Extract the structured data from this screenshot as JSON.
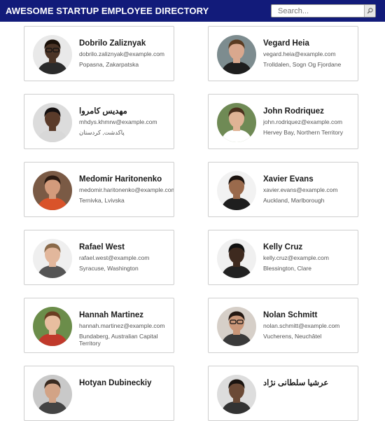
{
  "header": {
    "title": "AWESOME STARTUP EMPLOYEE DIRECTORY",
    "background": "#121b7a",
    "search_placeholder": "Search...",
    "search_icon": "magnifier-icon"
  },
  "employees": [
    {
      "name": "Dobrilo Zaliznyak",
      "email": "dobrilo.zaliznyak@example.com",
      "location": "Popasna, Zakarpatska",
      "avatar": {
        "bg": "#e9e9e9",
        "skin": "#4b3426",
        "hair": "#1a1008",
        "shirt": "#2b2b2b",
        "glasses": true
      }
    },
    {
      "name": "Vegard Heia",
      "email": "vegard.heia@example.com",
      "location": "Trolldalen, Sogn Og Fjordane",
      "avatar": {
        "bg": "#7d8c8f",
        "skin": "#d9a88e",
        "hair": "#5a3b22",
        "shirt": "#1e1e1e",
        "glasses": false
      }
    },
    {
      "name": "مهدیس کامروا",
      "email": "mhdys.khmrw@example.com",
      "location": "پاکدشت, کردستان",
      "avatar": {
        "bg": "#dcdcdc",
        "skin": "#5a3b2a",
        "hair": "#151010",
        "shirt": "#d8d8d8",
        "glasses": false
      }
    },
    {
      "name": "John Rodriquez",
      "email": "john.rodriquez@example.com",
      "location": "Hervey Bay, Northern Territory",
      "avatar": {
        "bg": "#6f8a55",
        "skin": "#e0b395",
        "hair": "#4a2f1c",
        "shirt": "#ffffff",
        "glasses": false
      }
    },
    {
      "name": "Medomir Haritonenko",
      "email": "medomir.haritonenko@example.com",
      "location": "Ternivka, Lvivska",
      "avatar": {
        "bg": "#7a5a45",
        "skin": "#d39b7c",
        "hair": "#2a1a12",
        "shirt": "#d9532a",
        "glasses": false
      }
    },
    {
      "name": "Xavier Evans",
      "email": "xavier.evans@example.com",
      "location": "Auckland, Marlborough",
      "avatar": {
        "bg": "#f2f2f2",
        "skin": "#9a6a4c",
        "hair": "#1b130f",
        "shirt": "#1e1e1e",
        "glasses": false
      }
    },
    {
      "name": "Rafael West",
      "email": "rafael.west@example.com",
      "location": "Syracuse, Washington",
      "avatar": {
        "bg": "#efefef",
        "skin": "#e2b79c",
        "hair": "#8a6a4a",
        "shirt": "#555555",
        "glasses": false
      }
    },
    {
      "name": "Kelly Cruz",
      "email": "kelly.cruz@example.com",
      "location": "Blessington, Clare",
      "avatar": {
        "bg": "#f0f0f0",
        "skin": "#3e2a1f",
        "hair": "#111111",
        "shirt": "#222222",
        "glasses": false
      }
    },
    {
      "name": "Hannah Martinez",
      "email": "hannah.martinez@example.com",
      "location": "Bundaberg, Australian Capital Territory",
      "avatar": {
        "bg": "#6b8d4a",
        "skin": "#e8bea0",
        "hair": "#6a3e22",
        "shirt": "#c0392b",
        "glasses": false
      }
    },
    {
      "name": "Nolan Schmitt",
      "email": "nolan.schmitt@example.com",
      "location": "Vucherens, Neuchâtel",
      "avatar": {
        "bg": "#d6cfc8",
        "skin": "#c99678",
        "hair": "#241812",
        "shirt": "#3a3a3a",
        "glasses": true
      }
    },
    {
      "name": "Hotyan Dubineckiy",
      "email": "",
      "location": "",
      "avatar": {
        "bg": "#c9c9c9",
        "skin": "#d2a386",
        "hair": "#3a2a20",
        "shirt": "#444444",
        "glasses": false
      }
    },
    {
      "name": "عرشیا سلطانی نژاد",
      "email": "",
      "location": "",
      "avatar": {
        "bg": "#dddddd",
        "skin": "#6b4a36",
        "hair": "#1a1410",
        "shirt": "#333333",
        "glasses": false
      }
    }
  ]
}
